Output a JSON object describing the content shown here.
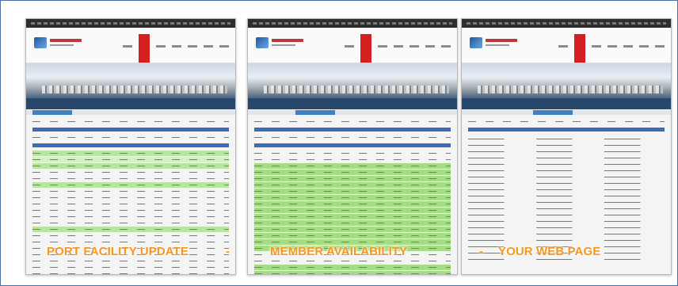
{
  "captions": {
    "port_facility": "PORT FACILITY UPDATE",
    "dash_1": "-",
    "member_availability": "MEMBER AVAILABILITY",
    "dash_2": "-",
    "your_web_page": "YOUR WEB PAGE"
  },
  "colors": {
    "caption": "#f5961e",
    "frame_border": "#4a6fa5",
    "nav_active": "#d42020",
    "row_green": "#b9e3a0",
    "header_blue": "#3a6db5"
  }
}
